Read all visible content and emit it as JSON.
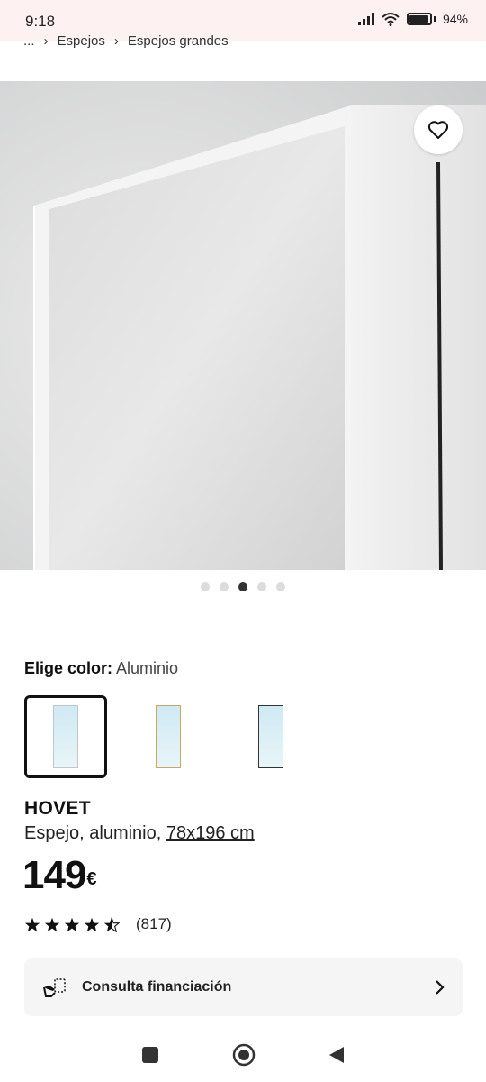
{
  "status": {
    "time": "9:18",
    "battery": "94%",
    "battery_level": 0.94
  },
  "breadcrumb": {
    "ellipsis": "...",
    "items": [
      "Espejos",
      "Espejos grandes"
    ]
  },
  "gallery": {
    "dot_count": 5,
    "active_index": 2
  },
  "color": {
    "label": "Elige color:",
    "value": "Aluminio",
    "swatch_count": 3,
    "selected_index": 0
  },
  "product": {
    "name": "HOVET",
    "desc_prefix": "Espejo, aluminio, ",
    "dimensions": "78x196 cm",
    "price": "149",
    "currency": "€"
  },
  "rating": {
    "stars": 4.5,
    "count": "(817)"
  },
  "finance": {
    "label": "Consulta financiación"
  },
  "colors": {
    "accent": "#111111",
    "finance_bg": "#f5f5f5"
  }
}
